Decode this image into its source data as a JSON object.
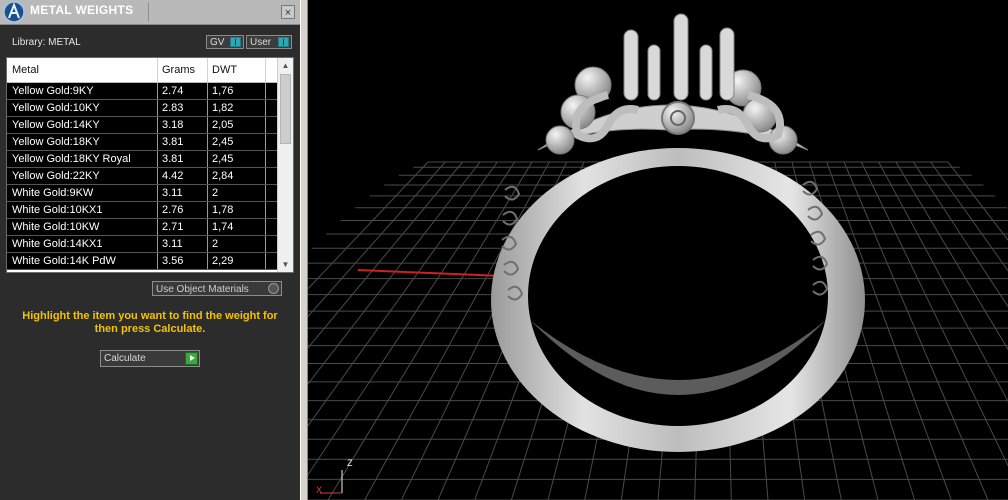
{
  "panel": {
    "title": "METAL WEIGHTS",
    "close_glyph": "×",
    "library_label": "Library: METAL",
    "toggles": [
      {
        "label": "GV",
        "icon": "toggle-icon"
      },
      {
        "label": "User",
        "icon": "toggle-icon"
      }
    ],
    "table": {
      "columns": [
        "Metal",
        "Grams",
        "DWT"
      ],
      "rows": [
        {
          "metal": "Yellow Gold:9KY",
          "grams": "2.74",
          "dwt": "1,76"
        },
        {
          "metal": "Yellow Gold:10KY",
          "grams": "2.83",
          "dwt": "1,82"
        },
        {
          "metal": "Yellow Gold:14KY",
          "grams": "3.18",
          "dwt": "2,05"
        },
        {
          "metal": "Yellow Gold:18KY",
          "grams": "3.81",
          "dwt": "2,45"
        },
        {
          "metal": "Yellow Gold:18KY Royal",
          "grams": "3.81",
          "dwt": "2,45"
        },
        {
          "metal": "Yellow Gold:22KY",
          "grams": "4.42",
          "dwt": "2,84"
        },
        {
          "metal": "White Gold:9KW",
          "grams": "3.11",
          "dwt": "2"
        },
        {
          "metal": "White Gold:10KX1",
          "grams": "2.76",
          "dwt": "1,78"
        },
        {
          "metal": "White Gold:10KW",
          "grams": "2.71",
          "dwt": "1,74"
        },
        {
          "metal": "White Gold:14KX1",
          "grams": "3.11",
          "dwt": "2"
        },
        {
          "metal": "White Gold:14K PdW",
          "grams": "3.56",
          "dwt": "2,29"
        }
      ]
    },
    "use_object_materials_label": "Use Object Materials",
    "hint": "Highlight the item you want to find the weight for then press Calculate.",
    "calculate_label": "Calculate"
  },
  "viewport": {
    "axis_z_label": "Z",
    "axis_x_label": "X",
    "colors": {
      "grid": "#4a4a4a",
      "x_axis": "#d12020",
      "y_axis": "#1aa7c0",
      "ring": "#cfcfcf",
      "hint_text": "#f4c300"
    }
  }
}
